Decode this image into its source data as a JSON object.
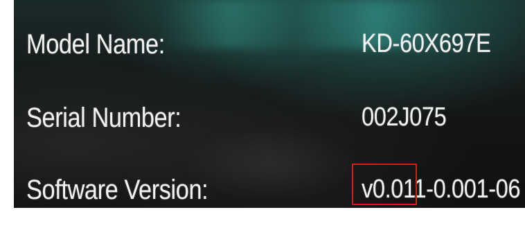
{
  "info": {
    "model_label": "Model Name:",
    "model_value": "KD-60X697E",
    "serial_label": "Serial Number:",
    "serial_value": "002J075",
    "software_label": "Software Version:",
    "software_value": "v0.011-0.001-06"
  },
  "colors": {
    "text": "#f2f2f2",
    "highlight_box": "#e01818"
  }
}
